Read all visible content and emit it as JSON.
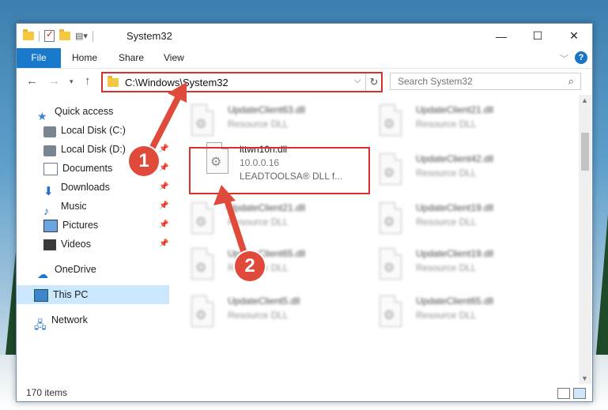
{
  "window": {
    "title": "System32",
    "minimize": "—",
    "maximize": "☐",
    "close": "✕"
  },
  "ribbon": {
    "tabs": [
      "File",
      "Home",
      "Share",
      "View"
    ],
    "help": "?"
  },
  "address": {
    "path": "C:\\Windows\\System32",
    "search_placeholder": "Search System32"
  },
  "nav": {
    "items": [
      {
        "label": "Quick access",
        "icon": "star-icon"
      },
      {
        "label": "Local Disk (C:)",
        "icon": "disk-icon"
      },
      {
        "label": "Local Disk (D:)",
        "icon": "disk-icon"
      },
      {
        "label": "Documents",
        "icon": "document-icon"
      },
      {
        "label": "Downloads",
        "icon": "download-icon"
      },
      {
        "label": "Music",
        "icon": "music-icon"
      },
      {
        "label": "Pictures",
        "icon": "pictures-icon"
      },
      {
        "label": "Videos",
        "icon": "video-icon"
      },
      {
        "label": "OneDrive",
        "icon": "cloud-icon"
      },
      {
        "label": "This PC",
        "icon": "pc-icon"
      },
      {
        "label": "Network",
        "icon": "network-icon"
      }
    ]
  },
  "files": [
    {
      "name": "UpdateClient63.dll",
      "type": "Resource DLL"
    },
    {
      "name": "UpdateClient21.dll",
      "type": "Resource DLL"
    },
    {
      "name": "lttwn10n.dll",
      "version": "10.0.0.16",
      "type": "LEADTOOLSA® DLL f..."
    },
    {
      "name": "UpdateClient42.dll",
      "type": "Resource DLL"
    },
    {
      "name": "UpdateClient21.dll",
      "type": "Resource DLL"
    },
    {
      "name": "UpdateClient19.dll",
      "type": "Resource DLL"
    },
    {
      "name": "UpdateClient65.dll",
      "type": "Resource DLL"
    },
    {
      "name": "UpdateClient19.dll",
      "type": "Resource DLL"
    },
    {
      "name": "UpdateClient5.dll",
      "type": "Resource DLL"
    },
    {
      "name": "UpdateClient65.dll",
      "type": "Resource DLL"
    }
  ],
  "status": {
    "count": "170 items"
  },
  "annotations": {
    "step1": "1",
    "step2": "2",
    "color": "#e04a3b"
  }
}
